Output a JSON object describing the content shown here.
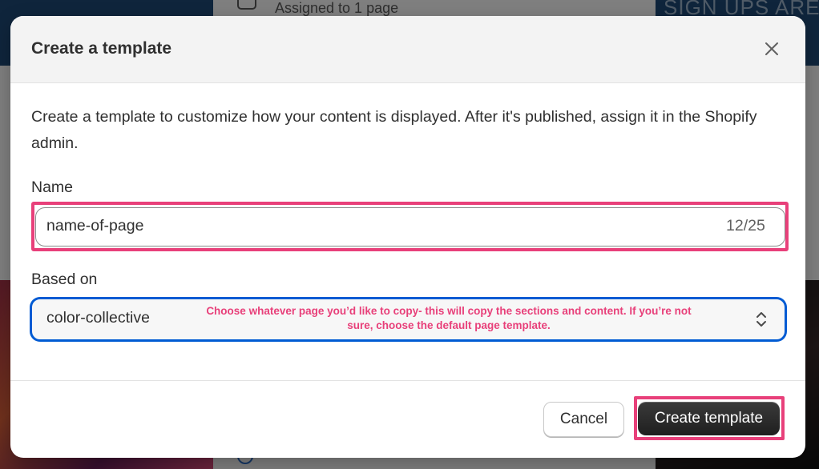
{
  "background": {
    "center_text": "Assigned to 1 page",
    "right_text": "SIGN UPS ARE"
  },
  "modal": {
    "title": "Create a template",
    "description": "Create a template to customize how your content is displayed. After it's published, assign it in the Shopify admin.",
    "name_field": {
      "label": "Name",
      "value": "name-of-page",
      "counter": "12/25"
    },
    "based_on_field": {
      "label": "Based on",
      "selected": "color-collective",
      "annotation": "Choose whatever page you’d like to copy- this will copy the sections and content. If you’re not sure, choose the default page template."
    },
    "buttons": {
      "cancel": "Cancel",
      "create": "Create template"
    }
  },
  "colors": {
    "highlight": "#e8407a",
    "focus_ring": "#005bd3",
    "primary_button": "#303030"
  },
  "icons": {
    "close": "close-icon",
    "select_chevron": "chevron-up-down-icon"
  }
}
